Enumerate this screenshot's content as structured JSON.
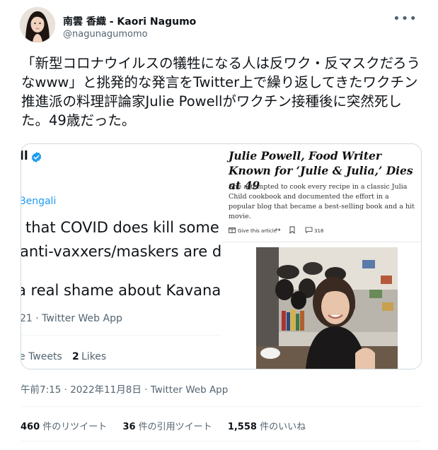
{
  "author": {
    "display_name": "南雲 香織 - Kaori Nagumo",
    "handle": "@nagunagumomo"
  },
  "tweet": {
    "text": "「新型コロナウイルスの犠牲になる人は反ワク・反マスクだろうなwww」と挑発的な発言をTwitter上で繰り返してきたワクチン推進派の料理評論家Julie Powellがワクチン接種後に突然死した。49歳だった。",
    "timestamp": "午前7:15 · 2022年11月8日 · Twitter Web App"
  },
  "stats": {
    "retweets": {
      "count": "460",
      "label": "件のリツイート"
    },
    "quotes": {
      "count": "36",
      "label": "件の引用ツイート"
    },
    "likes": {
      "count": "1,558",
      "label": "件のいいね"
    }
  },
  "media_left": {
    "name_fragment": "ll",
    "handle_fragment": "Bengali",
    "line1": "that COVID does kill some",
    "line2": "anti-vaxxers/maskers are dy",
    "line3": "a real shame about Kavana",
    "meta": "21 · Twitter Web App",
    "retweets_fragment": "e Tweets",
    "likes_count": "2",
    "likes_label": "Likes"
  },
  "media_right": {
    "headline": "Julie Powell, Food Writer Known for ‘Julie & Julia,’ Dies at 49",
    "subhead": "She attempted to cook every recipe in a classic Julia Child cookbook and documented the effort in a popular blog that became a best-selling book and a hit movie.",
    "share_label": "Give this article",
    "comments_count": "318"
  },
  "colors": {
    "verified_blue": "#1d9bf0",
    "secondary_text": "#536471"
  }
}
